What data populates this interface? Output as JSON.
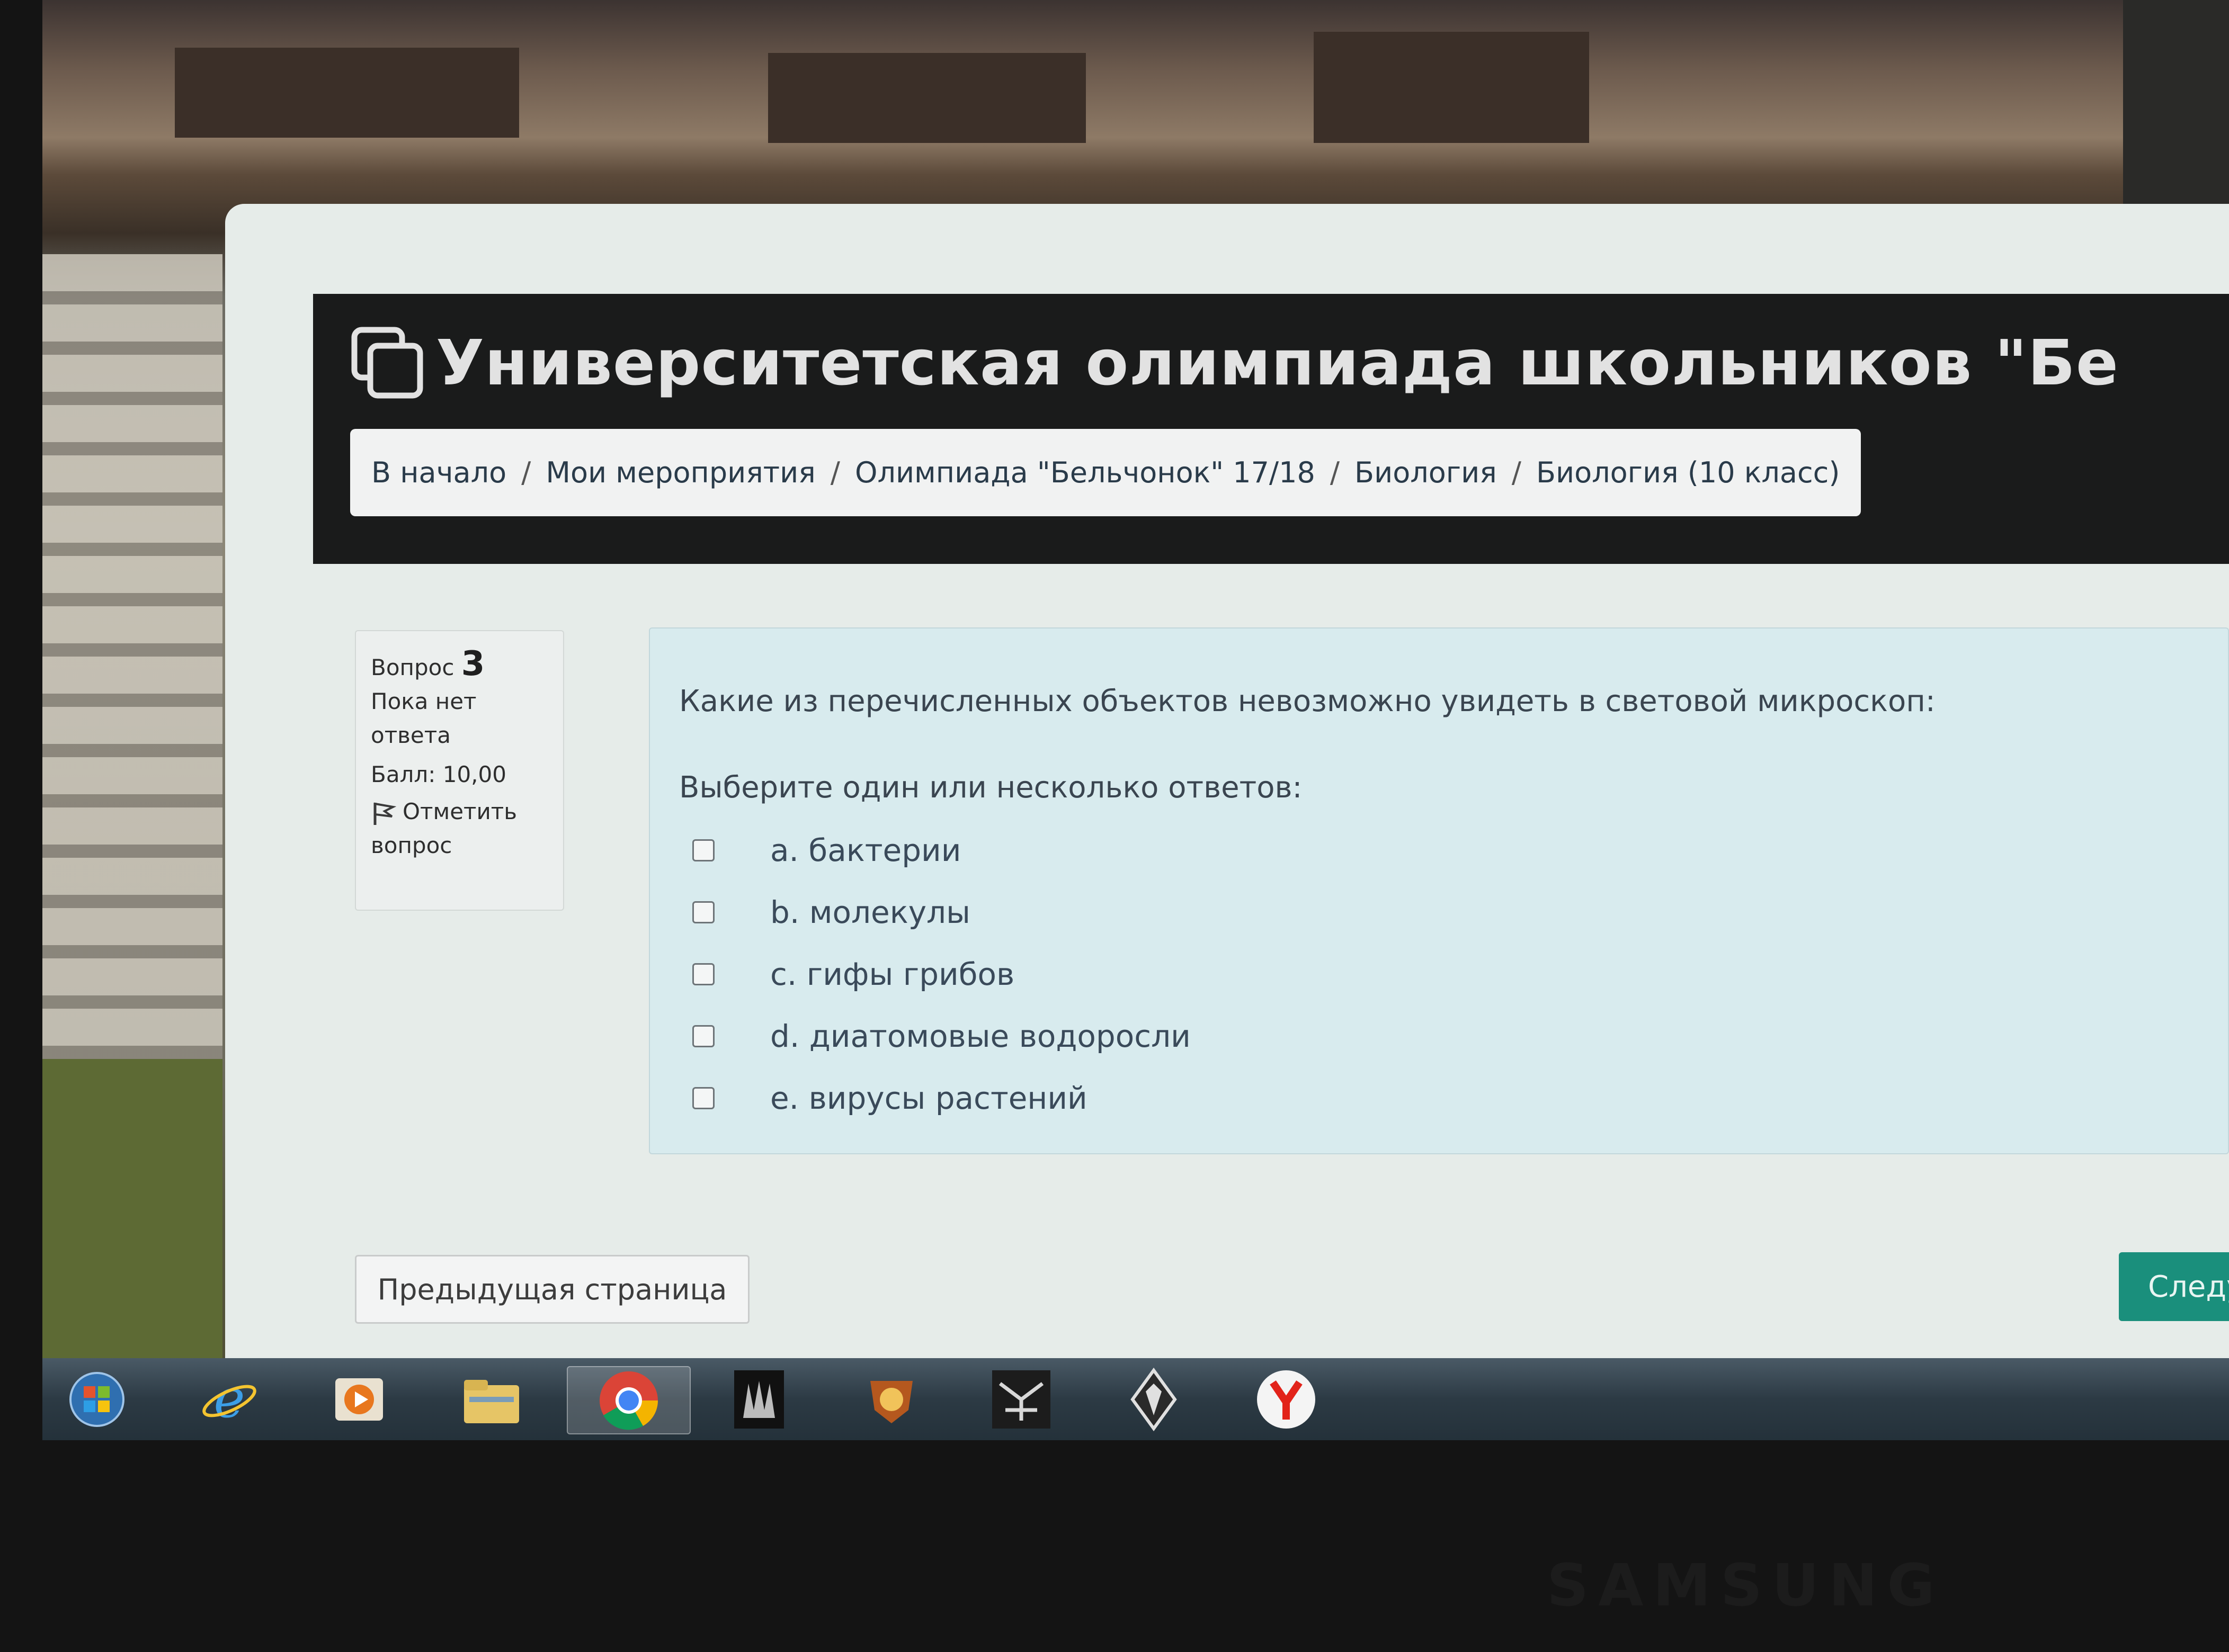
{
  "header": {
    "title": "Университетская олимпиада школьников \"Бе"
  },
  "breadcrumb": {
    "items": [
      "В начало",
      "Мои мероприятия",
      "Олимпиада \"Бельчонок\" 17/18",
      "Биология",
      "Биология (10 класс)"
    ],
    "separator": "/"
  },
  "question_info": {
    "label": "Вопрос",
    "number": "3",
    "status_line1": "Пока нет",
    "status_line2": "ответа",
    "score": "Балл: 10,00",
    "flag_line1": "Отметить",
    "flag_line2": "вопрос"
  },
  "question": {
    "text": "Какие из перечисленных объектов невозможно увидеть в световой микроскоп:",
    "prompt": "Выберите один или несколько ответов:",
    "answers": [
      {
        "letter": "a.",
        "text": "бактерии"
      },
      {
        "letter": "b.",
        "text": "молекулы"
      },
      {
        "letter": "c.",
        "text": "гифы грибов"
      },
      {
        "letter": "d.",
        "text": "диатомовые водоросли"
      },
      {
        "letter": "e.",
        "text": "вирусы растений"
      }
    ]
  },
  "navigation": {
    "prev_label": "Предыдущая страница",
    "next_label": "Следу"
  },
  "taskbar": {
    "items": [
      "windows-start-icon",
      "internet-explorer-icon",
      "media-player-icon",
      "file-explorer-icon",
      "chrome-icon",
      "game-icon-1",
      "game-icon-2",
      "dishonored-icon",
      "skyrim-icon",
      "yandex-browser-icon"
    ]
  },
  "monitor": {
    "brand": "SAMSUNG"
  },
  "colors": {
    "header_bg": "#1a1b1b",
    "question_bg": "#d8ebee",
    "next_button": "#1a8f7c"
  }
}
